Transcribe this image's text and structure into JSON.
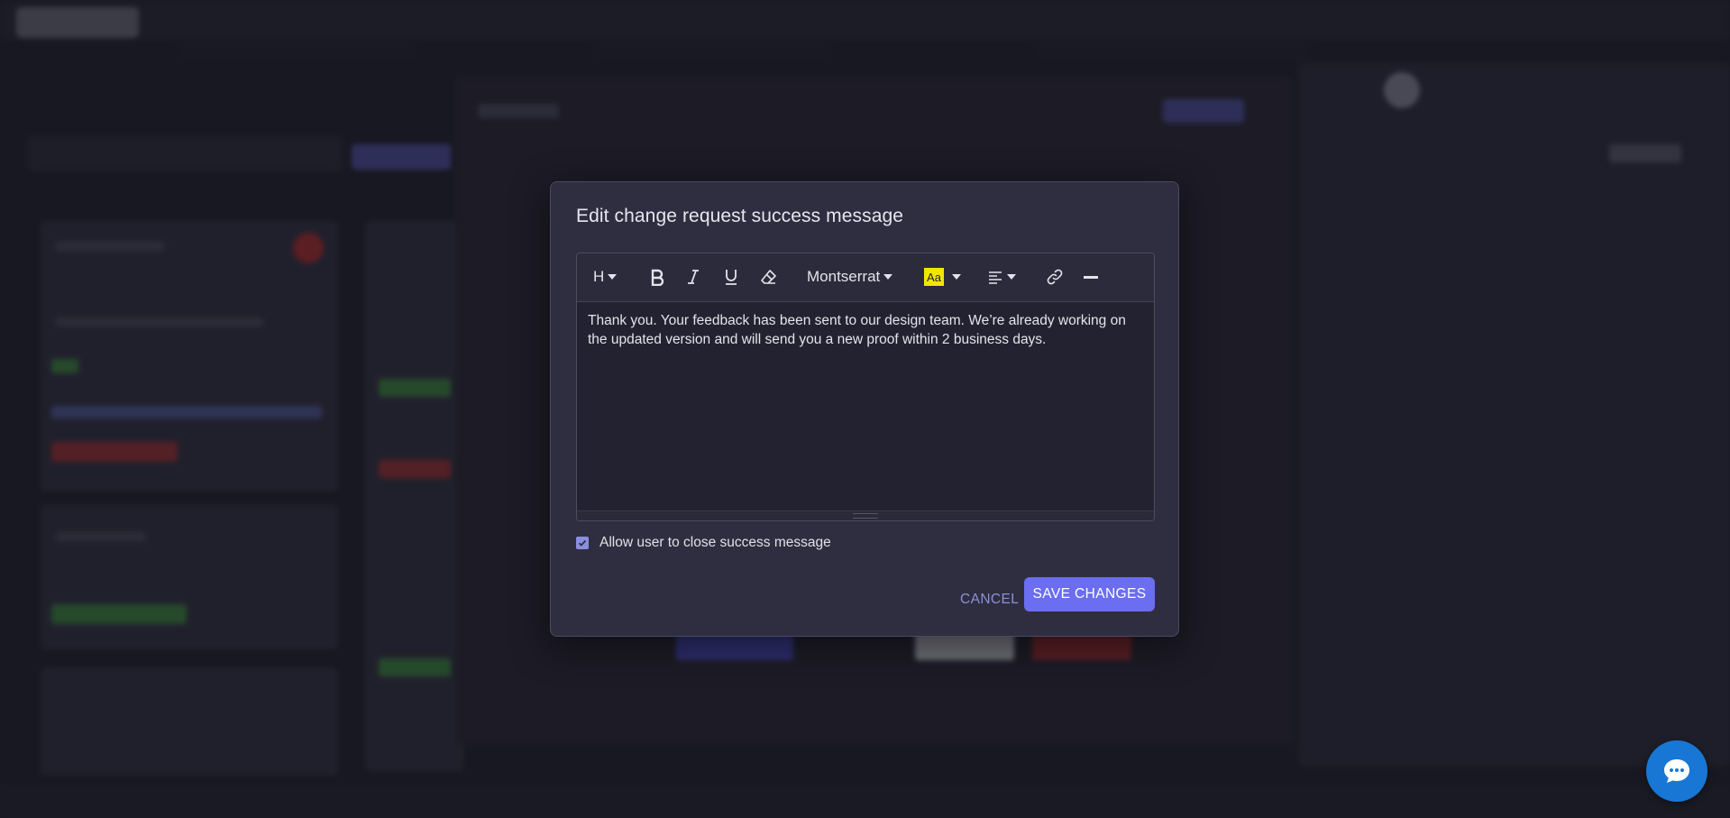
{
  "modal": {
    "title": "Edit change request success message",
    "toolbar": {
      "heading_label": "H",
      "font_name": "Montserrat",
      "highlight_swatch": "Aa",
      "highlight_color": "#f2e600"
    },
    "content_text": "Thank you. Your feedback has been sent to our design team. We’re already working on the updated version and will send you a new proof within 2 business days.",
    "checkbox": {
      "label": "Allow user to close success message",
      "checked": true
    },
    "cancel_label": "CANCEL",
    "save_label": "SAVE CHANGES"
  },
  "colors": {
    "accent": "#6b6ef0",
    "cancel_text": "#8d8fd8",
    "chat_button": "#1877d4"
  },
  "icons": {
    "bold": "bold-icon",
    "italic": "italic-icon",
    "underline": "underline-icon",
    "eraser": "eraser-icon",
    "align": "align-left-icon",
    "link": "link-icon",
    "hr": "horizontal-rule-icon",
    "chat": "chat-bubble-icon"
  }
}
